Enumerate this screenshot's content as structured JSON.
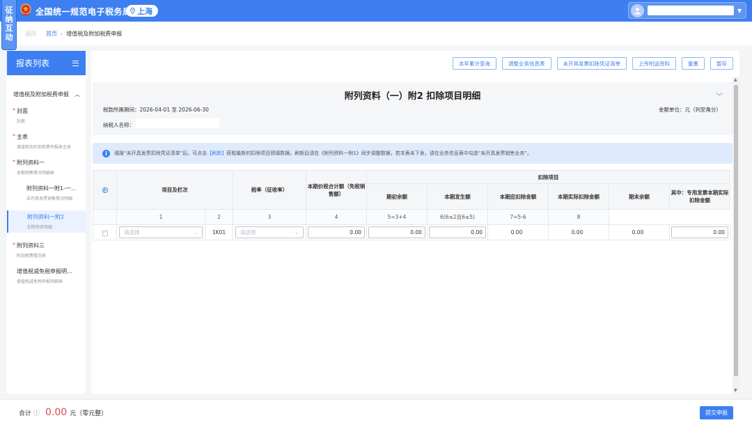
{
  "app": {
    "side_tab_lines": [
      "征",
      "纳",
      "互",
      "动"
    ],
    "site_title": "全国统一规范电子税务局",
    "region": "上海",
    "colors": {
      "primary": "#3d7ff0",
      "danger": "#e0484d",
      "header": "#3d7ff0"
    }
  },
  "breadcrumb": {
    "back": "返回",
    "home": "首页",
    "current": "增值税及附加税费申报"
  },
  "sidebar": {
    "title": "报表列表",
    "group": "增值税及附加税费申报",
    "items": [
      {
        "title": "封面",
        "subtitle": "封面",
        "required": true
      },
      {
        "title": "主表",
        "subtitle": "增值税及附加税费申报表主表",
        "required": true
      },
      {
        "title": "附列资料一",
        "subtitle": "本期销售情况明细表",
        "required": true
      },
      {
        "title": "附列资料一附1-一...",
        "subtitle": "未开具发票销售情况明细",
        "required": false
      },
      {
        "title": "附列资料一附2",
        "subtitle": "扣除项目明细",
        "required": false,
        "active": true
      },
      {
        "title": "附列资料三",
        "subtitle": "附加税费情况表",
        "required": true
      },
      {
        "title": "增值税减免税申报明...",
        "subtitle": "增值税减免税申报明细表",
        "required": false
      }
    ]
  },
  "toolbar": {
    "buttons": [
      "本年累计查询",
      "调整业务信息表",
      "未开具发票扣除凭证清单",
      "上传附送资料",
      "重置",
      "暂存"
    ]
  },
  "form": {
    "title": "附列资料（一）附2 扣除项目明细",
    "period_label": "税款所属期间：",
    "period_value": "2026-04-01 至 2026-06-30",
    "unit": "金额单位：元（列至角分）",
    "taxpayer_label": "纳税人名称："
  },
  "notice": {
    "part1": "填报“未开具发票扣除凭证清单”后，可点击",
    "link": "【刷新】",
    "part2": "获取最新的扣除项目预填数据。刷新后请在《附列资料一附1》同步调整数据，若本表未下发，请在业务信息表中勾选“未开具发票销售业务”。"
  },
  "table": {
    "headers": {
      "item": "项目及栏次",
      "rate": "税率（征收率）",
      "total": "本期价税合计额（免税销售额）",
      "deduction_group": "扣除项目",
      "opening": "期初余额",
      "current": "本期发生额",
      "deductible": "本期应扣除金额",
      "actual": "本期实际扣除金额",
      "closing": "期末余额",
      "special": "其中：专用发票本期实际扣除金额"
    },
    "column_numbers": [
      "1",
      "2",
      "3",
      "4",
      "5=3+4",
      "6(6≤2且6≤5)",
      "7=5-6",
      "8"
    ],
    "row": {
      "item_placeholder": "请选择",
      "code": "1K01",
      "rate_placeholder": "请选择",
      "total": "0.00",
      "opening": "0.00",
      "current": "0.00",
      "deductible": "0.00",
      "actual": "0.00",
      "closing": "0.00",
      "special": "0.00"
    }
  },
  "footer": {
    "label": "合计",
    "info_icon": "ⓘ",
    "amount": "0.00",
    "amount_text": "元（零元整）",
    "submit": "提交申报"
  }
}
